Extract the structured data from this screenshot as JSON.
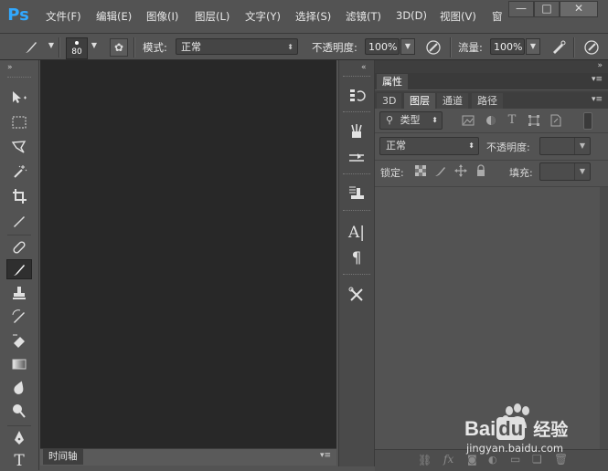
{
  "app": {
    "logo": "Ps"
  },
  "menu": [
    "文件(F)",
    "编辑(E)",
    "图像(I)",
    "图层(L)",
    "文字(Y)",
    "选择(S)",
    "滤镜(T)",
    "3D(D)",
    "视图(V)",
    "窗"
  ],
  "window_controls": {
    "minimize": "—",
    "maximize": "□",
    "close": "✕"
  },
  "options": {
    "brush_size": "80",
    "mode_label": "模式:",
    "mode_value": "正常",
    "opacity_label": "不透明度:",
    "opacity_value": "100%",
    "flow_label": "流量:",
    "flow_value": "100%"
  },
  "timeline": {
    "tab": "时间轴"
  },
  "properties": {
    "tab": "属性"
  },
  "layers_panel": {
    "tabs": [
      "3D",
      "图层",
      "通道",
      "路径"
    ],
    "active_tab": "图层",
    "filter_label": "类型",
    "blend_mode": "正常",
    "opacity_label": "不透明度:",
    "lock_label": "锁定:",
    "fill_label": "填充:"
  },
  "watermark": {
    "brand": "Bai",
    "brand_suffix": "du",
    "cn": "经验",
    "url": "jingyan.baidu.com"
  }
}
